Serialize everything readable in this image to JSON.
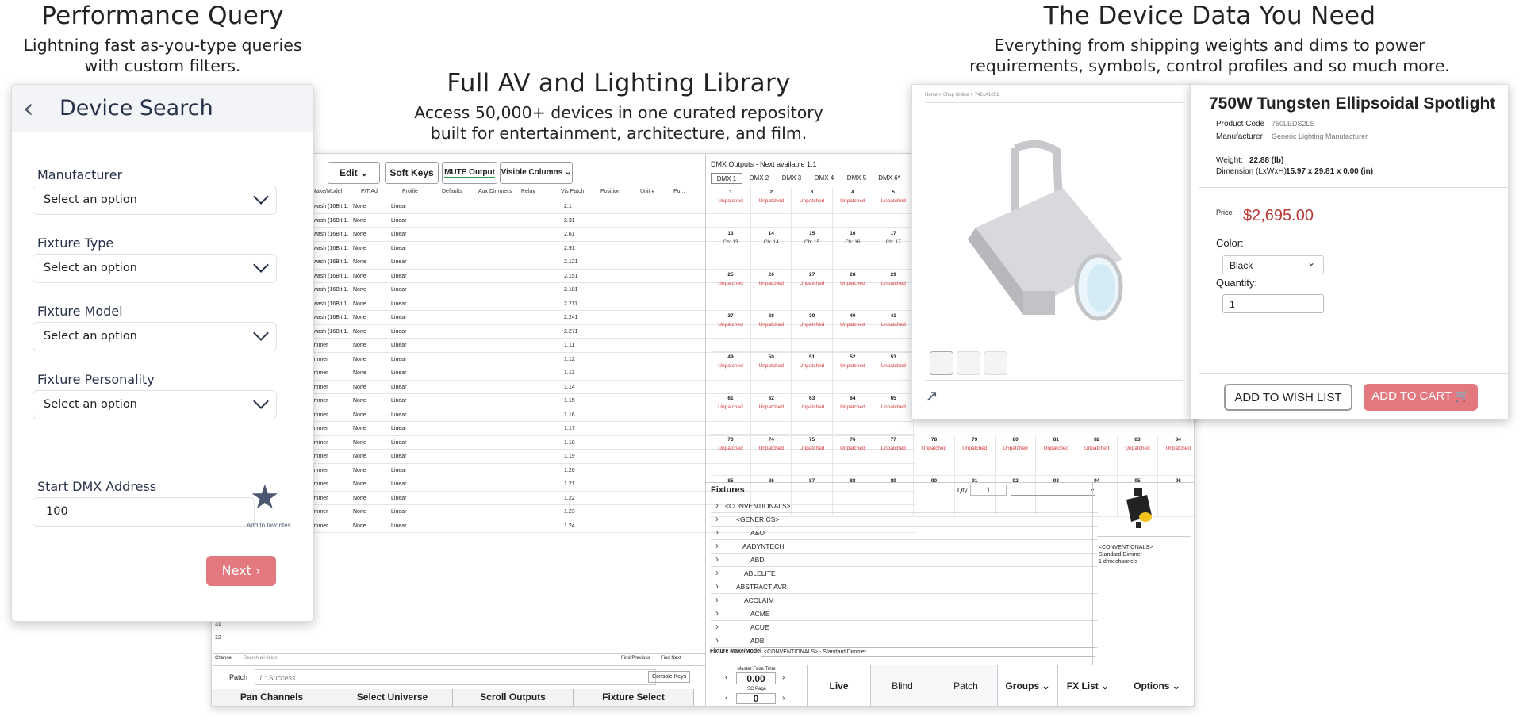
{
  "headers": {
    "perf": {
      "title": "Performance Query",
      "subtitle_line1": "Lightning fast as-you-type queries",
      "subtitle_line2": "with custom filters."
    },
    "library": {
      "title": "Full AV and Lighting Library",
      "subtitle_line1": "Access 50,000+ devices in one curated repository",
      "subtitle_line2": "built for entertainment, architecture, and film."
    },
    "device_data": {
      "title": "The Device Data You Need",
      "subtitle_line1": "Everything from shipping weights and dims to power",
      "subtitle_line2": "requirements, symbols, control profiles and so much more."
    }
  },
  "device_search": {
    "back_icon": "chevron-left-icon",
    "title": "Device Search",
    "fields": [
      {
        "label": "Manufacturer",
        "value": "Select an option"
      },
      {
        "label": "Fixture Type",
        "value": "Select an option"
      },
      {
        "label": "Fixture Model",
        "value": "Select an option"
      },
      {
        "label": "Fixture Personality",
        "value": "Select an option"
      }
    ],
    "dmx_label": "Start DMX Address",
    "dmx_value": "100",
    "favorites_label": "Add to favorites",
    "next_label": "Next",
    "next_icon": "chevron-right-icon",
    "accent": "#e3787e"
  },
  "patch": {
    "toolbar": {
      "edit": "Edit",
      "soft_keys": "Soft Keys",
      "mute": "MUTE Output",
      "visible_columns": "Visible Columns"
    },
    "columns": [
      "Make/Model",
      "P/T Adj",
      "Profile",
      "Defaults",
      "Aux Dimmers",
      "Relay",
      "Vis Patch",
      "Position",
      "Unit #",
      "Pu..."
    ],
    "rows": [
      {
        "model": "ntwash (16Bit 1.",
        "pt": "None",
        "profile": "Linear",
        "patch": "2.1"
      },
      {
        "model": "ntwash (16Bit 1.",
        "pt": "None",
        "profile": "Linear",
        "patch": "2.31"
      },
      {
        "model": "ntwash (16Bit 1.",
        "pt": "None",
        "profile": "Linear",
        "patch": "2.61"
      },
      {
        "model": "ntwash (16Bit 1.",
        "pt": "None",
        "profile": "Linear",
        "patch": "2.91"
      },
      {
        "model": "ntwash (16Bit 1.",
        "pt": "None",
        "profile": "Linear",
        "patch": "2.121"
      },
      {
        "model": "ntwash (16Bit 1.",
        "pt": "None",
        "profile": "Linear",
        "patch": "2.151"
      },
      {
        "model": "ntwash (16Bit 1.",
        "pt": "None",
        "profile": "Linear",
        "patch": "2.181"
      },
      {
        "model": "ntwash (16Bit 1.",
        "pt": "None",
        "profile": "Linear",
        "patch": "2.211"
      },
      {
        "model": "ntwash (16Bit 1.",
        "pt": "None",
        "profile": "Linear",
        "patch": "2.241"
      },
      {
        "model": "ntwash (16Bit 1.",
        "pt": "None",
        "profile": "Linear",
        "patch": "2.271"
      },
      {
        "model": "Dimmer",
        "pt": "None",
        "profile": "Linear",
        "patch": "1.11"
      },
      {
        "model": "Dimmer",
        "pt": "None",
        "profile": "Linear",
        "patch": "1.12"
      },
      {
        "model": "Dimmer",
        "pt": "None",
        "profile": "Linear",
        "patch": "1.13"
      },
      {
        "model": "Dimmer",
        "pt": "None",
        "profile": "Linear",
        "patch": "1.14"
      },
      {
        "model": "Dimmer",
        "pt": "None",
        "profile": "Linear",
        "patch": "1.15"
      },
      {
        "model": "Dimmer",
        "pt": "None",
        "profile": "Linear",
        "patch": "1.16"
      },
      {
        "model": "Dimmer",
        "pt": "None",
        "profile": "Linear",
        "patch": "1.17"
      },
      {
        "model": "Dimmer",
        "pt": "None",
        "profile": "Linear",
        "patch": "1.18"
      },
      {
        "model": "Dimmer",
        "pt": "None",
        "profile": "Linear",
        "patch": "1.19"
      },
      {
        "model": "Dimmer",
        "pt": "None",
        "profile": "Linear",
        "patch": "1.20"
      },
      {
        "model": "Dimmer",
        "pt": "None",
        "profile": "Linear",
        "patch": "1.21"
      },
      {
        "model": "Dimmer",
        "pt": "None",
        "profile": "Linear",
        "patch": "1.22"
      },
      {
        "model": "Dimmer",
        "pt": "None",
        "profile": "Linear",
        "patch": "1.23"
      },
      {
        "model": "Dimmer",
        "pt": "None",
        "profile": "Linear",
        "patch": "1.24"
      }
    ],
    "row_numbers": [
      "31",
      "32"
    ],
    "search": {
      "channel": "Channel",
      "placeholder": "Search all fields",
      "find_prev": "Find Previous",
      "find_next": "Find Next"
    },
    "cmd": {
      "label": "Patch",
      "value": "1 : Success",
      "console_keys": "Console Keys"
    },
    "bottom": [
      "Pan Channels",
      "Select Universe",
      "Scroll Outputs",
      "Fixture Select"
    ],
    "fade": {
      "label": "Master Fade Time",
      "value": "0.00",
      "sc_label": "SC Page",
      "sc_value": "0"
    },
    "modes": [
      "Live",
      "Blind",
      "Patch",
      "Groups",
      "FX List",
      "Options"
    ],
    "dmx": {
      "title": "DMX Outputs - Next available 1.1",
      "tabs": [
        "DMX 1",
        "DMX 2",
        "DMX 3",
        "DMX 4",
        "DMX 5",
        "DMX 6*"
      ],
      "unpatched": "Unpatched",
      "rows": [
        {
          "nums": [
            "1",
            "2",
            "3",
            "4",
            "5"
          ],
          "vals": [
            "Unpatched",
            "Unpatched",
            "Unpatched",
            "Unpatched",
            "Unpatched"
          ]
        },
        {
          "nums": [
            "13",
            "14",
            "15",
            "16",
            "17"
          ],
          "vals": [
            "Ch: 13",
            "Ch: 14",
            "Ch: 15",
            "Ch: 16",
            "Ch: 17"
          ]
        },
        {
          "nums": [
            "25",
            "26",
            "27",
            "28",
            "29"
          ],
          "vals": [
            "Unpatched",
            "Unpatched",
            "Unpatched",
            "Unpatched",
            "Unpatched"
          ]
        },
        {
          "nums": [
            "37",
            "38",
            "39",
            "40",
            "41"
          ],
          "vals": [
            "Unpatched",
            "Unpatched",
            "Unpatched",
            "Unpatched",
            "Unpatched"
          ]
        },
        {
          "nums": [
            "49",
            "50",
            "51",
            "52",
            "53"
          ],
          "vals": [
            "Unpatched",
            "Unpatched",
            "Unpatched",
            "Unpatched",
            "Unpatched"
          ]
        },
        {
          "nums": [
            "61",
            "62",
            "63",
            "64",
            "65"
          ],
          "vals": [
            "Unpatched",
            "Unpatched",
            "Unpatched",
            "Unpatched",
            "Unpatched"
          ]
        },
        {
          "nums": [
            "73",
            "74",
            "75",
            "76",
            "77",
            "78",
            "79",
            "80",
            "81",
            "82",
            "83",
            "84"
          ],
          "vals": [
            "Unpatched",
            "Unpatched",
            "Unpatched",
            "Unpatched",
            "Unpatched",
            "Unpatched",
            "Unpatched",
            "Unpatched",
            "Unpatched",
            "Unpatched",
            "Unpatched",
            "Unpatched"
          ]
        },
        {
          "nums": [
            "85",
            "86",
            "87",
            "88",
            "89",
            "90",
            "91",
            "92",
            "93",
            "94",
            "95",
            "96"
          ],
          "vals": []
        }
      ]
    },
    "fixtures": {
      "title": "Fixtures",
      "qty_label": "Qty",
      "qty_value": "1",
      "items": [
        "<CONVENTIONALS>",
        "<GENERICS>",
        "A&O",
        "AADYNTECH",
        "ABD",
        "ABLELITE",
        "ABSTRACT AVR",
        "ACCLAIM",
        "ACME",
        "ACUE",
        "ADB"
      ],
      "info": [
        "<CONVENTIONALS>",
        "Standard Dimmer",
        "1 dmx channels"
      ],
      "make_model_label": "Fixture Make/Model",
      "make_model_value": "<CONVENTIONALS> - Standard Dimmer"
    }
  },
  "product": {
    "breadcrumb": "Home > Shop Online > 7461A1051",
    "title": "750W Tungsten Ellipsoidal Spotlight",
    "code_label": "Product Code",
    "code": "750LEDS2LS",
    "mfr_label": "Manufacturer",
    "mfr": "Generic Lighting Manufacturer",
    "weight_label": "Weight:",
    "weight": "22.88 (lb)",
    "dim_label": "Dimension (LxWxH):",
    "dim": "15.97 x 29.81 x 0.00 (in)",
    "price_label": "Price:",
    "price": "$2,695.00",
    "color_label": "Color:",
    "color": "Black",
    "qty_label": "Quantity:",
    "qty": "1",
    "wish": "ADD TO WISH LIST",
    "cart": "ADD TO CART",
    "price_color": "#b83b38"
  }
}
